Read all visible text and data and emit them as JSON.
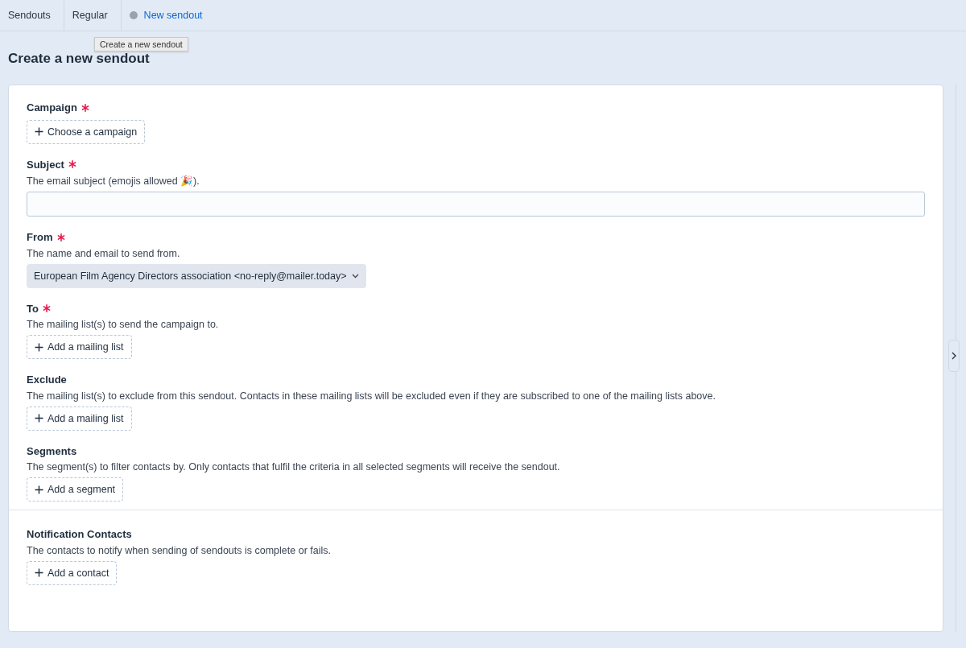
{
  "breadcrumb": [
    {
      "label": "Sendouts",
      "selected": false
    },
    {
      "label": "Regular",
      "selected": false
    },
    {
      "label": "New sendout",
      "selected": true
    }
  ],
  "tooltip": "Create a new sendout",
  "title": "Create a new sendout",
  "sections": [
    {
      "fields": [
        {
          "label": "Campaign",
          "required": true,
          "kind": "button",
          "button": "Choose a campaign"
        },
        {
          "label": "Subject",
          "required": true,
          "description": "The email subject (emojis allowed 🎉).",
          "kind": "input"
        },
        {
          "label": "From",
          "required": true,
          "description": "The name and email to send from.",
          "kind": "select",
          "value": "European Film Agency Directors association <no-reply@mailer.today>"
        },
        {
          "label": "To",
          "required": true,
          "description": "The mailing list(s) to send the campaign to.",
          "kind": "button",
          "button": "Add a mailing list"
        },
        {
          "label": "Exclude",
          "required": false,
          "description": "The mailing list(s) to exclude from this sendout. Contacts in these mailing lists will be excluded even if they are subscribed to one of the mailing lists above.",
          "kind": "button",
          "button": "Add a mailing list"
        },
        {
          "label": "Segments",
          "required": false,
          "description": "The segment(s) to filter contacts by. Only contacts that fulfil the criteria in all selected segments will receive the sendout.",
          "kind": "button",
          "button": "Add a segment"
        }
      ]
    },
    {
      "fields": [
        {
          "label": "Notification Contacts",
          "required": false,
          "description": "The contacts to notify when sending of sendouts is complete or fails.",
          "kind": "button",
          "button": "Add a contact"
        }
      ]
    }
  ]
}
